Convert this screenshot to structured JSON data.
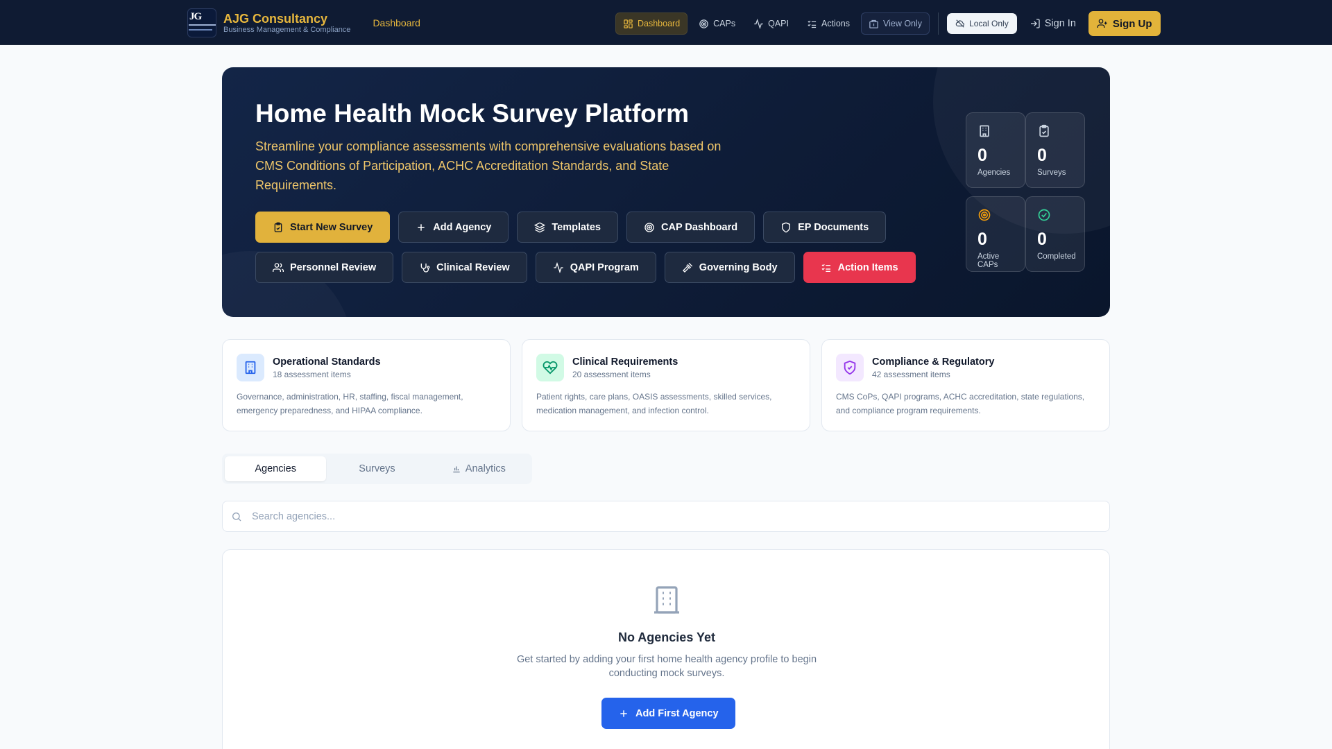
{
  "nav": {
    "brand_title": "AJG Consultancy",
    "brand_subtitle": "Business Management & Compliance",
    "breadcrumb": "Dashboard",
    "links": {
      "dashboard": "Dashboard",
      "caps": "CAPs",
      "qapi": "QAPI",
      "actions": "Actions",
      "view_only": "View Only"
    },
    "local_only": "Local Only",
    "sign_in": "Sign In",
    "sign_up": "Sign Up"
  },
  "hero": {
    "title": "Home Health Mock Survey Platform",
    "description": "Streamline your compliance assessments with comprehensive evaluations based on CMS Conditions of Participation, ACHC Accreditation Standards, and State Requirements.",
    "buttons": {
      "start_survey": "Start New Survey",
      "add_agency": "Add Agency",
      "templates": "Templates",
      "cap_dashboard": "CAP Dashboard",
      "ep_documents": "EP Documents",
      "personnel_review": "Personnel Review",
      "clinical_review": "Clinical Review",
      "qapi_program": "QAPI Program",
      "governing_body": "Governing Body",
      "action_items": "Action Items"
    },
    "stats": {
      "agencies": {
        "value": "0",
        "label": "Agencies"
      },
      "surveys": {
        "value": "0",
        "label": "Surveys"
      },
      "active_caps": {
        "value": "0",
        "label": "Active CAPs"
      },
      "completed": {
        "value": "0",
        "label": "Completed"
      }
    }
  },
  "categories": [
    {
      "title": "Operational Standards",
      "count": "18 assessment items",
      "description": "Governance, administration, HR, staffing, fiscal management, emergency preparedness, and HIPAA compliance."
    },
    {
      "title": "Clinical Requirements",
      "count": "20 assessment items",
      "description": "Patient rights, care plans, OASIS assessments, skilled services, medication management, and infection control."
    },
    {
      "title": "Compliance & Regulatory",
      "count": "42 assessment items",
      "description": "CMS CoPs, QAPI programs, ACHC accreditation, state regulations, and compliance program requirements."
    }
  ],
  "tabs": {
    "agencies": "Agencies",
    "surveys": "Surveys",
    "analytics": "Analytics"
  },
  "search": {
    "placeholder": "Search agencies..."
  },
  "empty_state": {
    "title": "No Agencies Yet",
    "description": "Get started by adding your first home health agency profile to begin conducting mock surveys.",
    "button": "Add First Agency"
  },
  "colors": {
    "accent_gold": "#e1b23c",
    "danger_red": "#e8364e",
    "primary_blue": "#2563eb",
    "navy": "#0f1b33"
  }
}
